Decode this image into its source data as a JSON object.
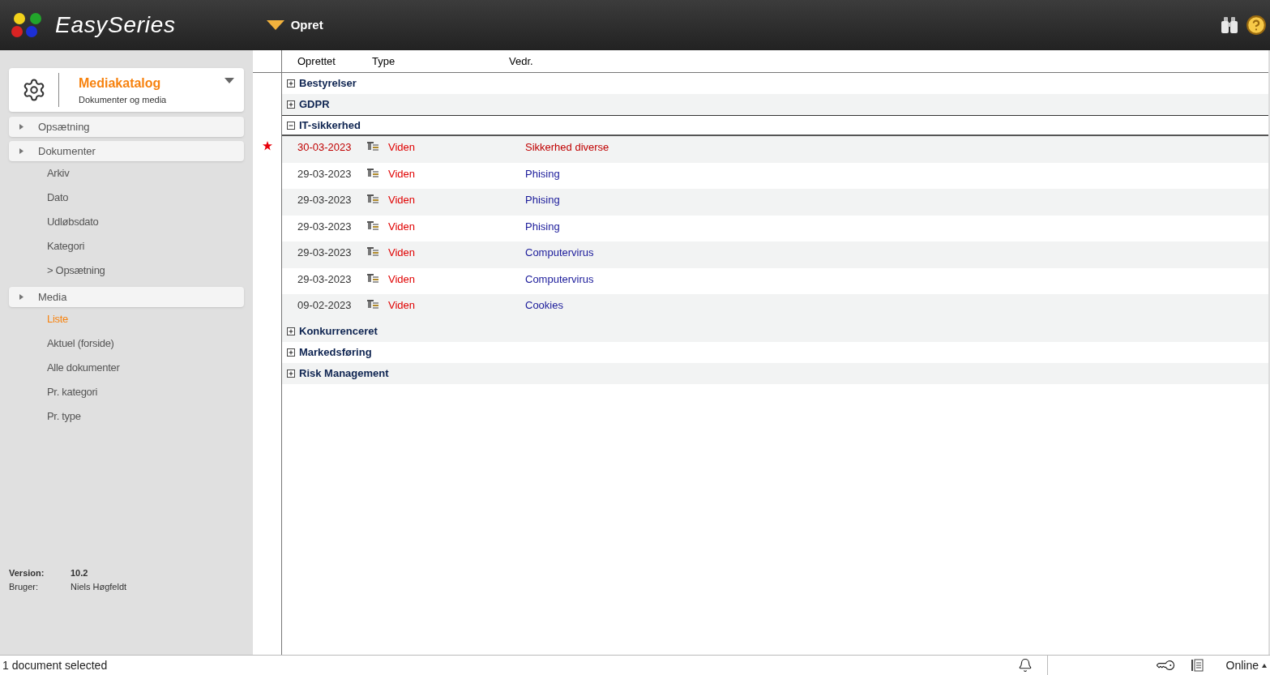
{
  "header": {
    "brand": "EasySeries",
    "menu_label": "Opret"
  },
  "sidebar": {
    "module": {
      "title": "Mediakatalog",
      "subtitle": "Dokumenter og media"
    },
    "sections": [
      {
        "label": "Opsætning"
      },
      {
        "label": "Dokumenter",
        "items": [
          {
            "label": "Arkiv",
            "selected": false
          },
          {
            "label": "Dato",
            "selected": false
          },
          {
            "label": "Udløbsdato",
            "selected": false
          },
          {
            "label": "Kategori",
            "selected": false
          },
          {
            "label": "> Opsætning",
            "selected": false
          }
        ]
      },
      {
        "label": "Media",
        "items": [
          {
            "label": "Liste",
            "selected": true
          },
          {
            "label": "Aktuel (forside)",
            "selected": false
          },
          {
            "label": "Alle dokumenter",
            "selected": false
          },
          {
            "label": "Pr. kategori",
            "selected": false
          },
          {
            "label": "Pr. type",
            "selected": false
          }
        ]
      }
    ],
    "info": [
      {
        "label": "Version:",
        "value": "10.2"
      },
      {
        "label": "Bruger:",
        "value": "Niels Høgfeldt"
      }
    ]
  },
  "table": {
    "columns": [
      "Oprettet",
      "Type",
      "Vedr."
    ],
    "groups": [
      {
        "name": "Bestyrelser",
        "expanded": false
      },
      {
        "name": "GDPR",
        "expanded": false
      },
      {
        "name": "IT-sikkerhed",
        "expanded": true,
        "rows": [
          {
            "created": "30-03-2023",
            "type": "Viden",
            "subject": "Sikkerhed diverse",
            "starred": true
          },
          {
            "created": "29-03-2023",
            "type": "Viden",
            "subject": "Phising",
            "starred": false
          },
          {
            "created": "29-03-2023",
            "type": "Viden",
            "subject": "Phising",
            "starred": false
          },
          {
            "created": "29-03-2023",
            "type": "Viden",
            "subject": "Phising",
            "starred": false
          },
          {
            "created": "29-03-2023",
            "type": "Viden",
            "subject": "Computervirus",
            "starred": false
          },
          {
            "created": "29-03-2023",
            "type": "Viden",
            "subject": "Computervirus",
            "starred": false
          },
          {
            "created": "09-02-2023",
            "type": "Viden",
            "subject": "Cookies",
            "starred": false
          }
        ]
      },
      {
        "name": "Konkurrenceret",
        "expanded": false
      },
      {
        "name": "Markedsføring",
        "expanded": false
      },
      {
        "name": "Risk Management",
        "expanded": false
      }
    ]
  },
  "status_bar": {
    "message": "1 document selected",
    "connection": "Online"
  }
}
